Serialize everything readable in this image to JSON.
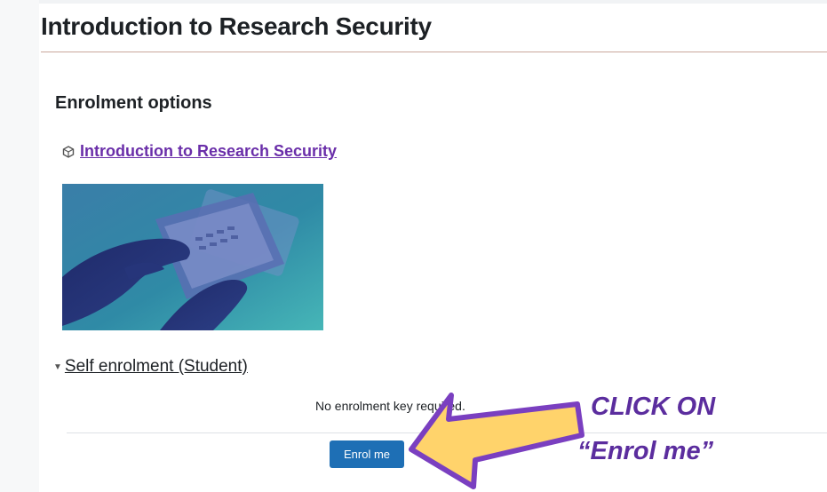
{
  "page": {
    "title": "Introduction to Research Security"
  },
  "enrolment": {
    "heading": "Enrolment options",
    "course_link": "Introduction to Research Security",
    "course_icon": "course-cube-icon",
    "course_image_alt": "hands-using-tablet-image",
    "method": {
      "label": "Self enrolment (Student)",
      "caret_icon": "caret-down-icon",
      "note": "No enrolment key required.",
      "button_label": "Enrol me"
    }
  },
  "annotation": {
    "line1": "CLICK ON",
    "line2": "“Enrol me”",
    "arrow_fill": "#ffd36b",
    "arrow_stroke": "#7a3fc0",
    "text_color": "#5b2d9e"
  },
  "colors": {
    "link": "#6a2ea9",
    "button": "#1e6fb5"
  }
}
